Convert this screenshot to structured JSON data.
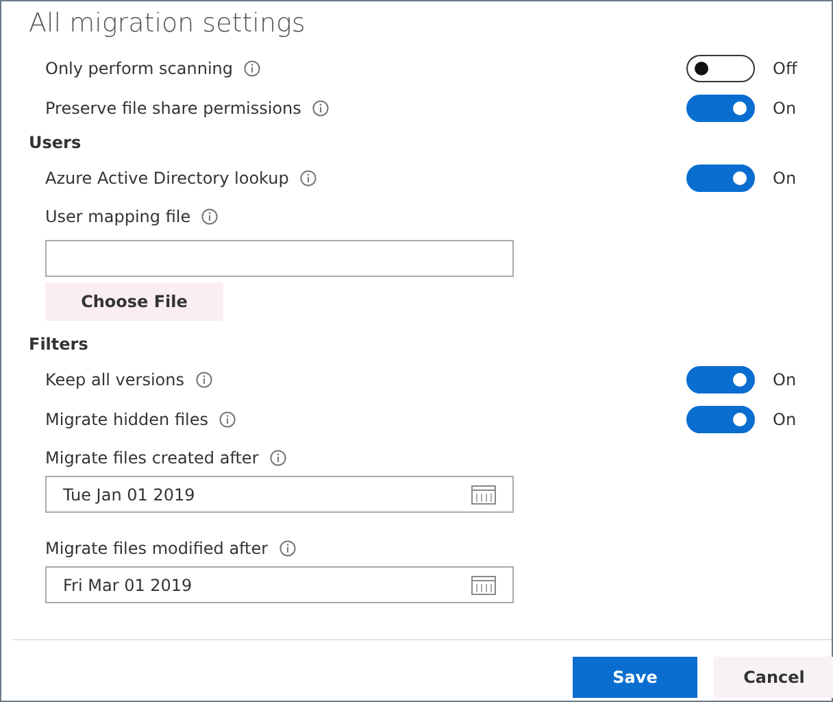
{
  "title": "All migration settings",
  "items": [
    {
      "kind": "toggle",
      "label": "Only perform scanning",
      "on": false,
      "state_text": "Off"
    },
    {
      "kind": "toggle",
      "label": "Preserve file share permissions",
      "on": true,
      "state_text": "On"
    },
    {
      "kind": "heading",
      "label": "Users"
    },
    {
      "kind": "toggle",
      "label": "Azure Active Directory lookup",
      "on": true,
      "state_text": "On"
    },
    {
      "kind": "file",
      "label": "User mapping file",
      "button": "Choose File"
    },
    {
      "kind": "heading",
      "label": "Filters"
    },
    {
      "kind": "toggle",
      "label": "Keep all versions",
      "on": true,
      "state_text": "On"
    },
    {
      "kind": "toggle",
      "label": "Migrate hidden files",
      "on": true,
      "state_text": "On"
    },
    {
      "kind": "date",
      "label": "Migrate files created after",
      "value": "Tue Jan 01 2019"
    },
    {
      "kind": "date",
      "label": "Migrate files modified after",
      "value": "Fri Mar 01 2019"
    }
  ],
  "buttons": [
    {
      "label": "Save",
      "primary": true
    },
    {
      "label": "Cancel",
      "primary": false
    }
  ]
}
